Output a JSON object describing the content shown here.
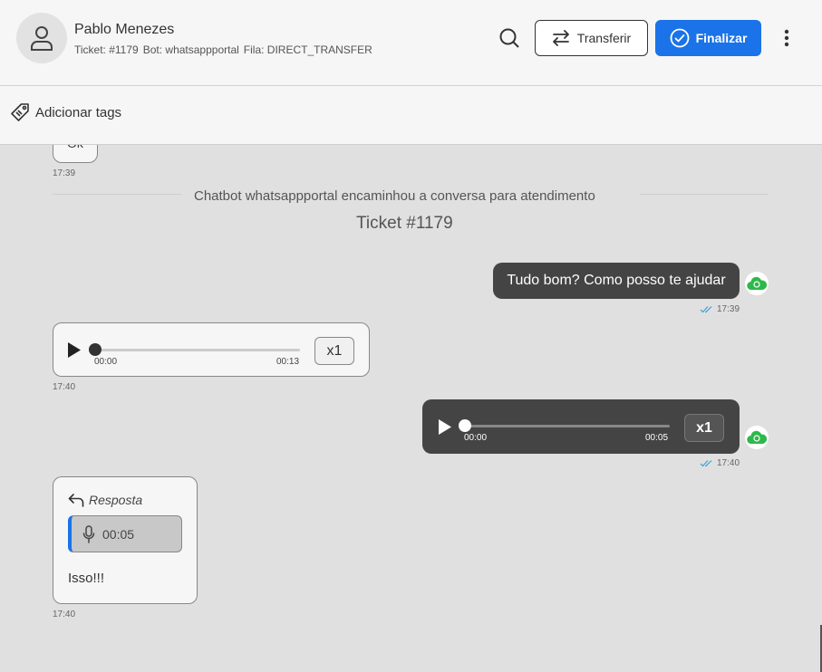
{
  "header": {
    "contact_name": "Pablo Menezes",
    "ticket_label": "Ticket: #1179",
    "bot_label": "Bot: whatsappportal",
    "queue_label": "Fila: DIRECT_TRANSFER",
    "transfer_label": "Transferir",
    "finalize_label": "Finalizar"
  },
  "tags": {
    "add_label": "Adicionar tags"
  },
  "chat": {
    "partial_bubble_text": "Ok",
    "partial_time": "17:39",
    "system_text": "Chatbot whatsappportal encaminhou a conversa para atendimento",
    "ticket_title": "Ticket #1179",
    "messages": [
      {
        "type": "text",
        "direction": "out",
        "text": "Tudo bom? Como posso te ajudar",
        "time": "17:39"
      },
      {
        "type": "audio",
        "direction": "in",
        "current": "00:00",
        "duration": "00:13",
        "speed": "x1",
        "progress": 0,
        "time": "17:40"
      },
      {
        "type": "audio",
        "direction": "out",
        "current": "00:00",
        "duration": "00:05",
        "speed": "x1",
        "progress": 0,
        "time": "17:40"
      },
      {
        "type": "reply",
        "direction": "in",
        "reply_label": "Resposta",
        "quoted_audio_duration": "00:05",
        "text": "Isso!!!",
        "time": "17:40"
      }
    ]
  },
  "colors": {
    "accent": "#1a73e8",
    "outgoing_bubble": "#444444",
    "incoming_bubble": "#f6f6f6",
    "whatsapp_green": "#2eb84b",
    "tick_blue": "#3aa0d8"
  }
}
